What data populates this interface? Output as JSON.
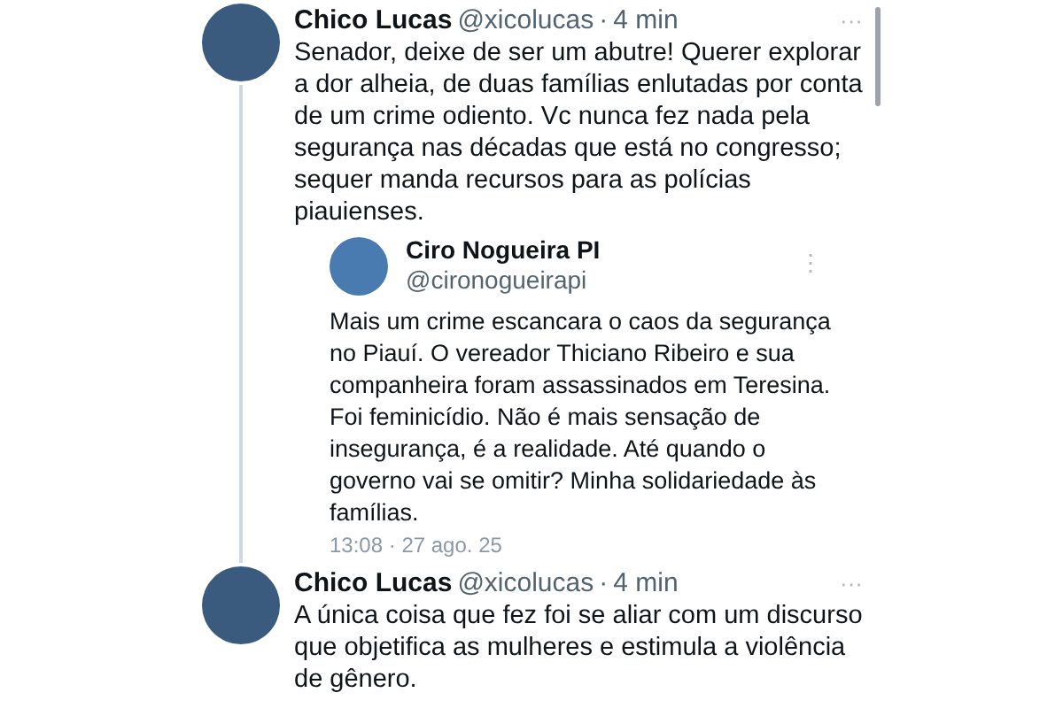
{
  "tweets": [
    {
      "author": "Chico Lucas",
      "handle": "@xicolucas",
      "separator": "·",
      "time": "4 min",
      "menu": "···",
      "thread_below": true,
      "text": "Senador, deixe de ser um abutre! Querer explorar a dor alheia, de duas famílias enlutadas por conta de um crime odiento. Vc nunca fez nada pela segurança nas décadas que está no congresso; sequer manda recursos para as polícias piauienses.",
      "quoted": {
        "author": "Ciro Nogueira PI",
        "handle": "@cironogueirapi",
        "menu": "⋮",
        "text": "Mais um crime escancara o caos da segurança no Piauí. O vereador Thiciano Ribeiro e sua companheira foram assassinados em Teresina. Foi feminicídio. Não é mais sensação de insegurança, é a realidade. Até quando o governo vai se omitir? Minha solidariedade às famílias.",
        "timestamp": "13:08 · 27 ago. 25"
      }
    },
    {
      "author": "Chico Lucas",
      "handle": "@xicolucas",
      "separator": "·",
      "time": "4 min",
      "menu": "···",
      "thread_below": false,
      "text": "A única coisa que fez foi se aliar com um discurso que objetifica as mulheres e estimula a violência de gênero."
    }
  ]
}
